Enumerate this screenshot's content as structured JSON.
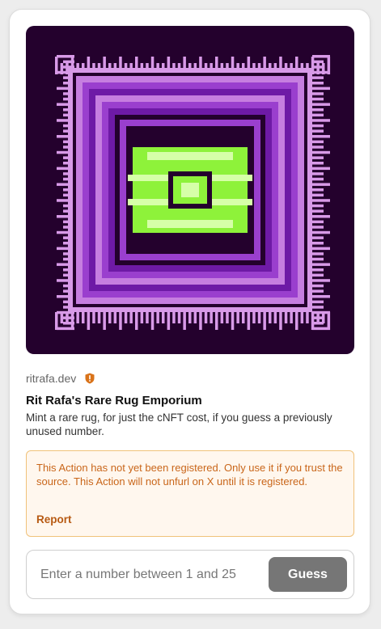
{
  "action": {
    "image_alt": "rare rug pixel art",
    "domain": "ritrafa.dev",
    "title": "Rit Rafa's Rare Rug Emporium",
    "description": "Mint a rare rug, for just the cNFT cost, if you guess a previously unused number."
  },
  "alert": {
    "icon": "warning-shield-icon",
    "text": "This Action has not yet been registered. Only use it if you trust the source. This Action will not unfurl on X until it is registered.",
    "report_label": "Report"
  },
  "form": {
    "placeholder": "Enter a number between 1 and 25",
    "value": "",
    "button_label": "Guess"
  },
  "colors": {
    "warning_text": "#c9661a",
    "warning_bg": "#fff7ee",
    "warning_border": "#f0c27a",
    "button_bg": "#767676",
    "rug_background": "#24012d",
    "rug_fringe": "#d89ae8",
    "rug_purple_light": "#c67ee0",
    "rug_purple": "#9a3fce",
    "rug_purple_dark": "#6e1aa6",
    "rug_green": "#8ef23a",
    "rug_green_light": "#d6ffa8"
  }
}
